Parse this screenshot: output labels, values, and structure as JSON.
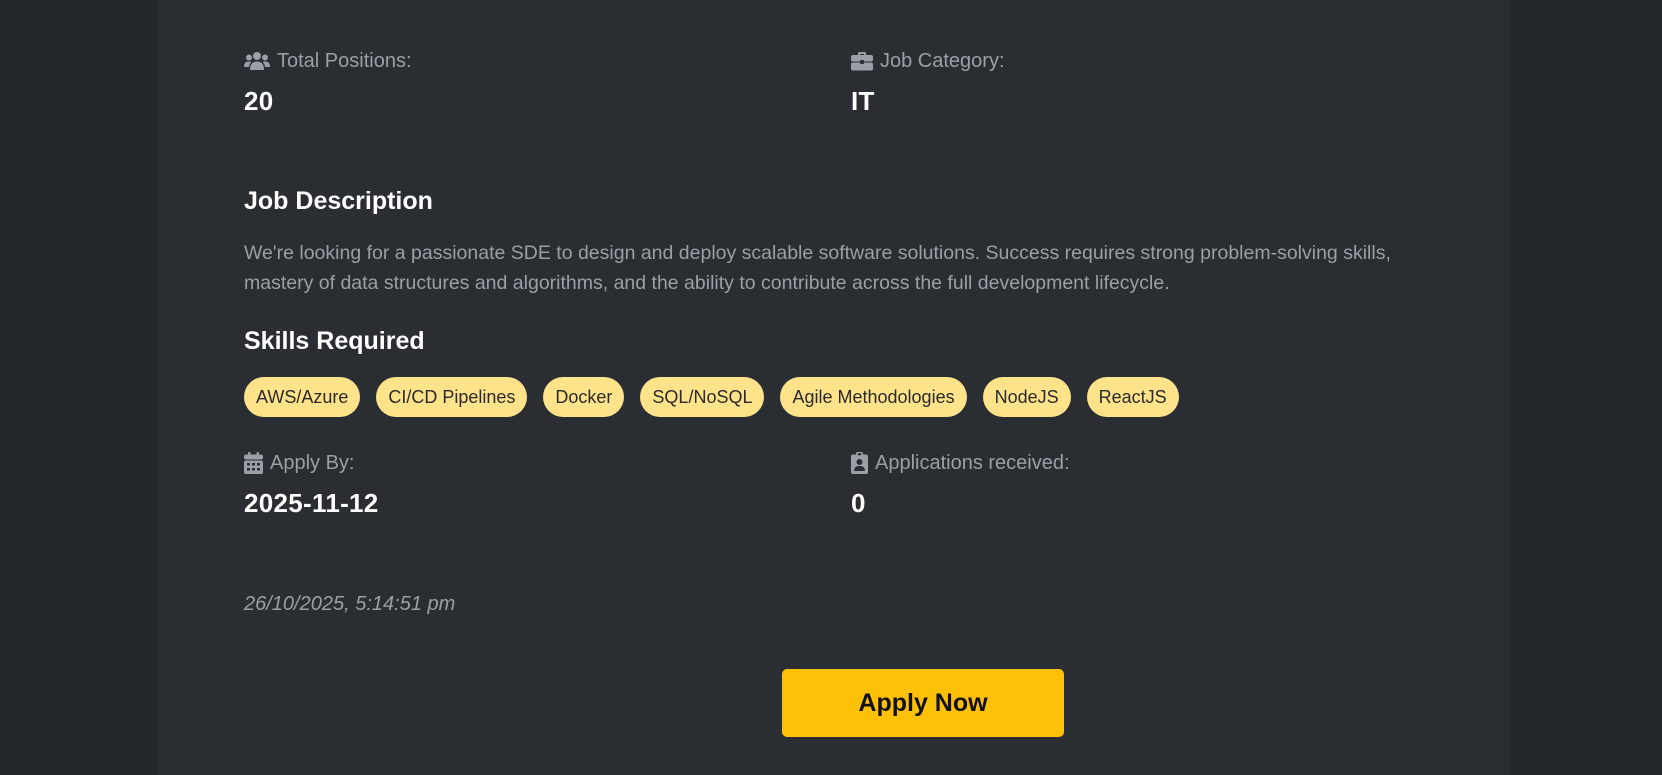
{
  "job": {
    "total_positions_label": "Total Positions:",
    "total_positions_value": "20",
    "job_category_label": "Job Category:",
    "job_category_value": "IT",
    "description_title": "Job Description",
    "description_text": "We're looking for a passionate SDE to design and deploy scalable software solutions. Success requires strong problem-solving skills, mastery of data structures and algorithms, and the ability to contribute across the full development lifecycle.",
    "skills_title": "Skills Required",
    "skills": [
      "AWS/Azure",
      "CI/CD Pipelines",
      "Docker",
      "SQL/NoSQL",
      "Agile Methodologies",
      "NodeJS",
      "ReactJS"
    ],
    "apply_by_label": "Apply By:",
    "apply_by_value": "2025-11-12",
    "applications_label": "Applications received:",
    "applications_value": "0",
    "timestamp": "26/10/2025, 5:14:51 pm",
    "apply_button_label": "Apply Now"
  },
  "icons": {
    "positions": "users-icon",
    "category": "briefcase-icon",
    "apply_by": "calendar-icon",
    "applications": "clipboard-user-icon"
  },
  "colors": {
    "background": "#24272b",
    "card": "#2a2d31",
    "muted_text": "#9aa0a6",
    "chip": "#ffe38a",
    "accent": "#ffc107"
  }
}
